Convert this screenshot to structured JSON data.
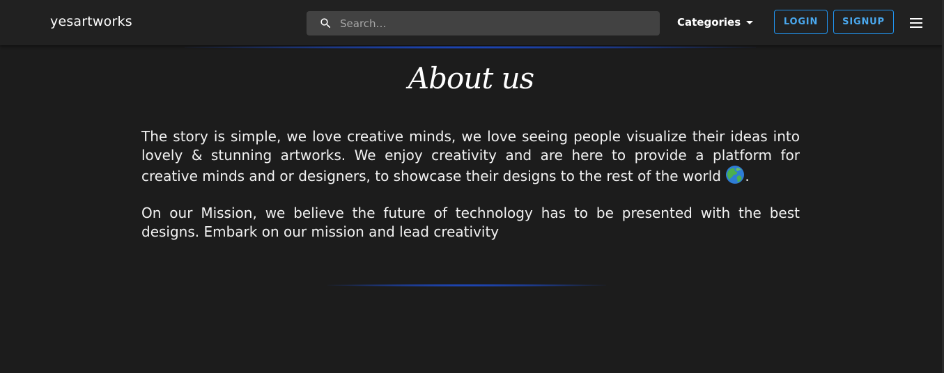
{
  "header": {
    "brand": "yesartworks",
    "search": {
      "placeholder": "Search…",
      "value": ""
    },
    "categories_label": "Categories",
    "login_label": "LOGIN",
    "signup_label": "SIGNUP"
  },
  "main": {
    "title": "About us",
    "paragraph1": "The story is simple, we love creative minds, we love seeing people visualize their ideas into lovely & stunning artworks. We enjoy creativity and are here to provide a platform for creative minds and or designers, to showcase their designs to the rest of the world",
    "paragraph1_end": ".",
    "paragraph2": "On our Mission, we believe the future of technology has to be presented with the best designs. Embark on our mission and lead creativity"
  },
  "icons": {
    "search": "search-icon",
    "categories_dropdown": "caret-down-icon",
    "menu": "hamburger-menu-icon",
    "globe": "globe-icon"
  },
  "colors": {
    "background": "#1c1c1c",
    "appbar": "#212121",
    "search_field": "#424242",
    "accent": "#2196f3",
    "glow": "#1e50dc"
  }
}
